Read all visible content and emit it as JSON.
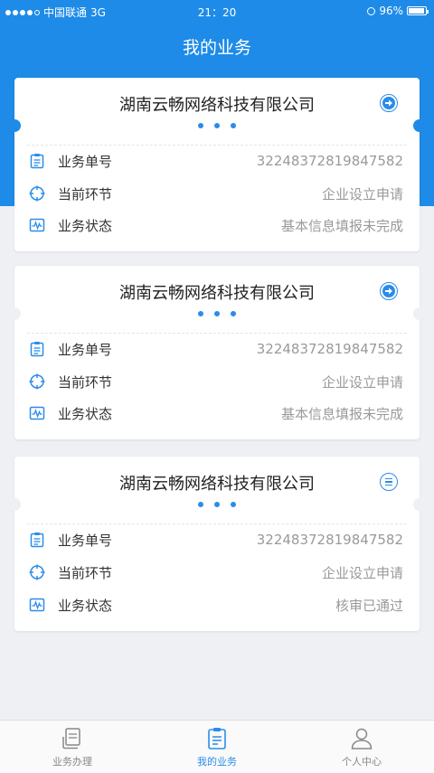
{
  "status_bar": {
    "carrier": "中国联通",
    "network": "3G",
    "time": "21：20",
    "battery": "96%"
  },
  "nav": {
    "title": "我的业务"
  },
  "cards": [
    {
      "company": "湖南云畅网络科技有限公司",
      "action_icon": "arrow-right-circle-icon",
      "rows": [
        {
          "icon": "clipboard-icon",
          "label": "业务单号",
          "value": "32248372819847582"
        },
        {
          "icon": "target-icon",
          "label": "当前环节",
          "value": "企业设立申请"
        },
        {
          "icon": "pulse-chart-icon",
          "label": "业务状态",
          "value": "基本信息填报未完成"
        }
      ]
    },
    {
      "company": "湖南云畅网络科技有限公司",
      "action_icon": "arrow-right-circle-icon",
      "rows": [
        {
          "icon": "clipboard-icon",
          "label": "业务单号",
          "value": "32248372819847582"
        },
        {
          "icon": "target-icon",
          "label": "当前环节",
          "value": "企业设立申请"
        },
        {
          "icon": "pulse-chart-icon",
          "label": "业务状态",
          "value": "基本信息填报未完成"
        }
      ]
    },
    {
      "company": "湖南云畅网络科技有限公司",
      "action_icon": "list-circle-icon",
      "rows": [
        {
          "icon": "clipboard-icon",
          "label": "业务单号",
          "value": "32248372819847582"
        },
        {
          "icon": "target-icon",
          "label": "当前环节",
          "value": "企业设立申请"
        },
        {
          "icon": "pulse-chart-icon",
          "label": "业务状态",
          "value": "核审已通过"
        }
      ]
    }
  ],
  "tabbar": [
    {
      "label": "业务办理",
      "icon": "document-stack-icon",
      "active": false
    },
    {
      "label": "我的业务",
      "icon": "clipboard-list-icon",
      "active": true
    },
    {
      "label": "个人中心",
      "icon": "person-icon",
      "active": false
    }
  ],
  "colors": {
    "primary": "#1e8be8",
    "accent": "#2a8cea",
    "background": "#eef0f3"
  }
}
